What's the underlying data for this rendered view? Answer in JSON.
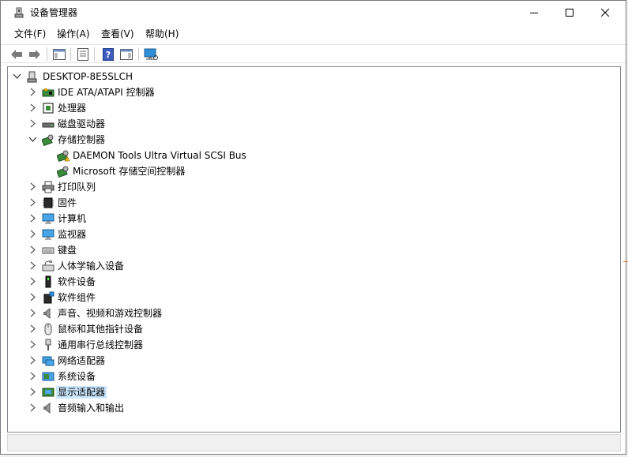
{
  "window": {
    "title": "设备管理器"
  },
  "menu": [
    {
      "label": "文件(F)"
    },
    {
      "label": "操作(A)"
    },
    {
      "label": "查看(V)"
    },
    {
      "label": "帮助(H)"
    }
  ],
  "toolbar": {
    "back_icon": "arrow-left-icon",
    "forward_icon": "arrow-right-icon",
    "buttons": [
      "show-hide-console-tree-icon",
      "properties-icon",
      "help-icon",
      "action-pane-icon",
      "scan-hardware-icon"
    ]
  },
  "tree": {
    "root": {
      "label": "DESKTOP-8E5SLCH",
      "icon": "computer-icon"
    },
    "items": [
      {
        "label": "IDE ATA/ATAPI 控制器",
        "icon": "ide-controller-icon"
      },
      {
        "label": "处理器",
        "icon": "processor-icon"
      },
      {
        "label": "磁盘驱动器",
        "icon": "disk-drive-icon"
      },
      {
        "label": "存储控制器",
        "icon": "storage-controller-icon",
        "expanded": true,
        "children": [
          {
            "label": "DAEMON Tools Ultra Virtual SCSI Bus",
            "icon": "storage-controller-warning-icon"
          },
          {
            "label": "Microsoft 存储空间控制器",
            "icon": "storage-controller-icon"
          }
        ]
      },
      {
        "label": "打印队列",
        "icon": "printer-icon"
      },
      {
        "label": "固件",
        "icon": "firmware-icon"
      },
      {
        "label": "计算机",
        "icon": "computer-monitor-icon"
      },
      {
        "label": "监视器",
        "icon": "monitor-icon"
      },
      {
        "label": "键盘",
        "icon": "keyboard-icon"
      },
      {
        "label": "人体学输入设备",
        "icon": "hid-icon"
      },
      {
        "label": "软件设备",
        "icon": "software-device-icon"
      },
      {
        "label": "软件组件",
        "icon": "software-component-icon"
      },
      {
        "label": "声音、视频和游戏控制器",
        "icon": "speaker-icon"
      },
      {
        "label": "鼠标和其他指针设备",
        "icon": "mouse-icon"
      },
      {
        "label": "通用串行总线控制器",
        "icon": "usb-icon"
      },
      {
        "label": "网络适配器",
        "icon": "network-adapter-icon"
      },
      {
        "label": "系统设备",
        "icon": "system-device-icon"
      },
      {
        "label": "显示适配器",
        "icon": "display-adapter-icon",
        "selected": true
      },
      {
        "label": "音频输入和输出",
        "icon": "audio-io-icon"
      }
    ]
  },
  "colors": {
    "selection": "#cce8ff",
    "accent": "#0078d7",
    "warning": "#f5c211"
  }
}
